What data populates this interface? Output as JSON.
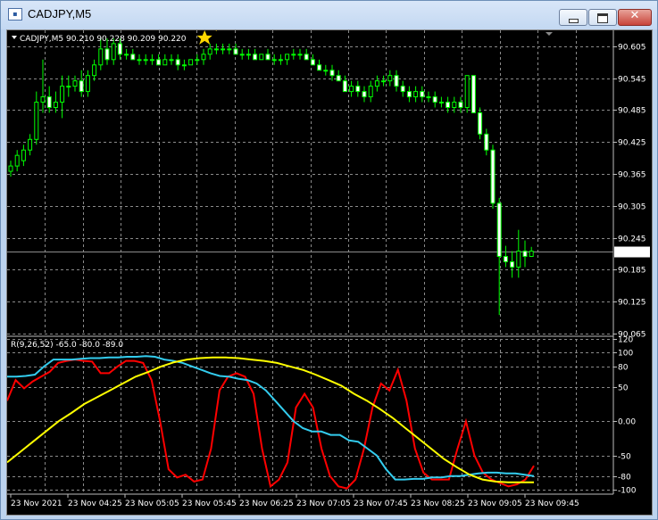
{
  "window": {
    "title": "CADJPY,M5",
    "close_glyph": "✕"
  },
  "price_panel": {
    "header": "CADJPY,M5  90.210 90.228 90.209 90.220",
    "current_price": "90.220",
    "bull_color": "#00ff00",
    "bear_color": "#ffffff",
    "signal_color": "#ffd700",
    "signal_icons": [
      "star-icon",
      "down-arrow-icon"
    ]
  },
  "indicator_panel": {
    "header": "R(9,26,52) -65.0 -80.0 -89.0",
    "colors": {
      "fast": "#ff0000",
      "mid": "#33ccee",
      "slow": "#ffff00"
    }
  },
  "time_axis_labels": [
    "23 Nov 2021",
    "23 Nov 04:25",
    "23 Nov 05:05",
    "23 Nov 05:45",
    "23 Nov 06:25",
    "23 Nov 07:05",
    "23 Nov 07:45",
    "23 Nov 08:25",
    "23 Nov 09:05",
    "23 Nov 09:45"
  ],
  "chart_data": [
    {
      "type": "line",
      "subtype": "candlestick",
      "title": "CADJPY,M5",
      "symbol": "CADJPY",
      "timeframe": "M5",
      "last_ohlc": {
        "open": 90.21,
        "high": 90.228,
        "low": 90.209,
        "close": 90.22
      },
      "ylim": [
        90.065,
        90.635
      ],
      "y_ticks": [
        "90.605",
        "90.545",
        "90.485",
        "90.425",
        "90.365",
        "90.305",
        "90.245",
        "90.185",
        "90.125",
        "90.065"
      ],
      "x_tick_labels": [
        "23 Nov 2021",
        "23 Nov 04:25",
        "23 Nov 05:05",
        "23 Nov 05:45",
        "23 Nov 06:25",
        "23 Nov 07:05",
        "23 Nov 07:45",
        "23 Nov 08:25",
        "23 Nov 09:05",
        "23 Nov 09:45"
      ],
      "candles": [
        [
          90.37,
          90.39,
          90.36,
          90.38
        ],
        [
          90.38,
          90.41,
          90.37,
          90.4
        ],
        [
          90.39,
          90.42,
          90.38,
          90.41
        ],
        [
          90.41,
          90.44,
          90.4,
          90.43
        ],
        [
          90.43,
          90.52,
          90.42,
          90.5
        ],
        [
          90.5,
          90.58,
          90.48,
          90.51
        ],
        [
          90.51,
          90.53,
          90.48,
          90.49
        ],
        [
          90.49,
          90.52,
          90.48,
          90.5
        ],
        [
          90.5,
          90.55,
          90.47,
          90.53
        ],
        [
          90.53,
          90.55,
          90.51,
          90.53
        ],
        [
          90.53,
          90.55,
          90.52,
          90.54
        ],
        [
          90.54,
          90.56,
          90.51,
          90.52
        ],
        [
          90.52,
          90.56,
          90.51,
          90.55
        ],
        [
          90.55,
          90.58,
          90.54,
          90.57
        ],
        [
          90.57,
          90.62,
          90.56,
          90.6
        ],
        [
          90.6,
          90.62,
          90.57,
          90.58
        ],
        [
          90.58,
          90.62,
          90.57,
          90.61
        ],
        [
          90.61,
          90.62,
          90.58,
          90.59
        ],
        [
          90.59,
          90.6,
          90.58,
          90.59
        ],
        [
          90.59,
          90.6,
          90.58,
          90.58
        ],
        [
          90.58,
          90.59,
          90.57,
          90.58
        ],
        [
          90.58,
          90.59,
          90.57,
          90.58
        ],
        [
          90.58,
          90.59,
          90.57,
          90.58
        ],
        [
          90.58,
          90.59,
          90.57,
          90.57
        ],
        [
          90.57,
          90.59,
          90.57,
          90.58
        ],
        [
          90.58,
          90.59,
          90.57,
          90.58
        ],
        [
          90.58,
          90.59,
          90.56,
          90.57
        ],
        [
          90.57,
          90.58,
          90.56,
          90.57
        ],
        [
          90.57,
          90.58,
          90.57,
          90.58
        ],
        [
          90.58,
          90.59,
          90.57,
          90.58
        ],
        [
          90.58,
          90.6,
          90.57,
          90.59
        ],
        [
          90.59,
          90.61,
          90.58,
          90.6
        ],
        [
          90.6,
          90.61,
          90.59,
          90.6
        ],
        [
          90.6,
          90.61,
          90.59,
          90.6
        ],
        [
          90.6,
          90.61,
          90.59,
          90.6
        ],
        [
          90.6,
          90.61,
          90.59,
          90.59
        ],
        [
          90.59,
          90.6,
          90.58,
          90.59
        ],
        [
          90.59,
          90.6,
          90.58,
          90.59
        ],
        [
          90.59,
          90.6,
          90.58,
          90.58
        ],
        [
          90.58,
          90.59,
          90.58,
          90.59
        ],
        [
          90.59,
          90.6,
          90.58,
          90.58
        ],
        [
          90.58,
          90.59,
          90.57,
          90.58
        ],
        [
          90.58,
          90.59,
          90.57,
          90.58
        ],
        [
          90.58,
          90.59,
          90.57,
          90.59
        ],
        [
          90.59,
          90.6,
          90.58,
          90.59
        ],
        [
          90.59,
          90.6,
          90.58,
          90.59
        ],
        [
          90.59,
          90.6,
          90.58,
          90.58
        ],
        [
          90.58,
          90.59,
          90.57,
          90.57
        ],
        [
          90.57,
          90.58,
          90.56,
          90.56
        ],
        [
          90.56,
          90.57,
          90.55,
          90.56
        ],
        [
          90.56,
          90.57,
          90.54,
          90.55
        ],
        [
          90.55,
          90.56,
          90.54,
          90.54
        ],
        [
          90.54,
          90.55,
          90.52,
          90.52
        ],
        [
          90.52,
          90.54,
          90.51,
          90.53
        ],
        [
          90.53,
          90.54,
          90.51,
          90.52
        ],
        [
          90.52,
          90.53,
          90.5,
          90.51
        ],
        [
          90.51,
          90.54,
          90.5,
          90.53
        ],
        [
          90.53,
          90.55,
          90.52,
          90.54
        ],
        [
          90.54,
          90.55,
          90.53,
          90.54
        ],
        [
          90.54,
          90.56,
          90.53,
          90.55
        ],
        [
          90.55,
          90.56,
          90.52,
          90.53
        ],
        [
          90.53,
          90.54,
          90.51,
          90.52
        ],
        [
          90.52,
          90.53,
          90.5,
          90.51
        ],
        [
          90.51,
          90.53,
          90.5,
          90.52
        ],
        [
          90.52,
          90.53,
          90.5,
          90.51
        ],
        [
          90.51,
          90.52,
          90.5,
          90.51
        ],
        [
          90.51,
          90.52,
          90.49,
          90.5
        ],
        [
          90.5,
          90.51,
          90.49,
          90.5
        ],
        [
          90.5,
          90.51,
          90.48,
          90.49
        ],
        [
          90.49,
          90.51,
          90.48,
          90.5
        ],
        [
          90.5,
          90.51,
          90.48,
          90.49
        ],
        [
          90.49,
          90.55,
          90.48,
          90.55
        ],
        [
          90.55,
          90.55,
          90.48,
          90.48
        ],
        [
          90.48,
          90.49,
          90.43,
          90.44
        ],
        [
          90.44,
          90.45,
          90.4,
          90.41
        ],
        [
          90.41,
          90.42,
          90.3,
          90.31
        ],
        [
          90.31,
          90.32,
          90.1,
          90.21
        ],
        [
          90.21,
          90.23,
          90.19,
          90.2
        ],
        [
          90.2,
          90.22,
          90.17,
          90.19
        ],
        [
          90.19,
          90.26,
          90.17,
          90.22
        ],
        [
          90.22,
          90.24,
          90.19,
          90.21
        ],
        [
          90.21,
          90.228,
          90.209,
          90.22
        ]
      ]
    },
    {
      "type": "line",
      "title": "R(9,26,52) -65.0 -80.0 -89.0",
      "ylim": [
        -105,
        120
      ],
      "y_ticks": [
        "120",
        "100",
        "80",
        "50",
        "0.00",
        "-50",
        "-80",
        "-100"
      ],
      "series": [
        {
          "name": "9",
          "last": -65.0,
          "values": [
            30,
            60,
            48,
            58,
            65,
            72,
            85,
            88,
            90,
            88,
            87,
            70,
            70,
            80,
            88,
            88,
            85,
            60,
            0,
            -70,
            -82,
            -78,
            -88,
            -85,
            -40,
            45,
            65,
            70,
            65,
            40,
            -40,
            -95,
            -85,
            -60,
            20,
            40,
            20,
            -40,
            -80,
            -95,
            -98,
            -85,
            -40,
            20,
            55,
            45,
            75,
            30,
            -40,
            -75,
            -85,
            -85,
            -85,
            -40,
            0,
            -50,
            -75,
            -85,
            -90,
            -95,
            -92,
            -85,
            -65
          ]
        },
        {
          "name": "26",
          "last": -80.0,
          "values": [
            65,
            65,
            66,
            68,
            80,
            90,
            90,
            90,
            91,
            92,
            92,
            93,
            93,
            94,
            94,
            95,
            94,
            90,
            88,
            85,
            80,
            75,
            70,
            66,
            65,
            62,
            60,
            55,
            45,
            30,
            15,
            0,
            -10,
            -15,
            -15,
            -20,
            -20,
            -28,
            -30,
            -40,
            -50,
            -70,
            -85,
            -85,
            -84,
            -84,
            -82,
            -82,
            -80,
            -80,
            -78,
            -76,
            -75,
            -75,
            -76,
            -76,
            -78,
            -80
          ]
        },
        {
          "name": "52",
          "last": -89.0,
          "values": [
            -60,
            -45,
            -30,
            -15,
            0,
            12,
            25,
            35,
            45,
            55,
            65,
            72,
            80,
            86,
            90,
            92,
            93,
            93,
            92,
            90,
            88,
            85,
            80,
            75,
            68,
            60,
            52,
            40,
            30,
            18,
            5,
            -10,
            -25,
            -40,
            -55,
            -67,
            -78,
            -85,
            -88,
            -89,
            -89,
            -89
          ]
        }
      ]
    }
  ]
}
